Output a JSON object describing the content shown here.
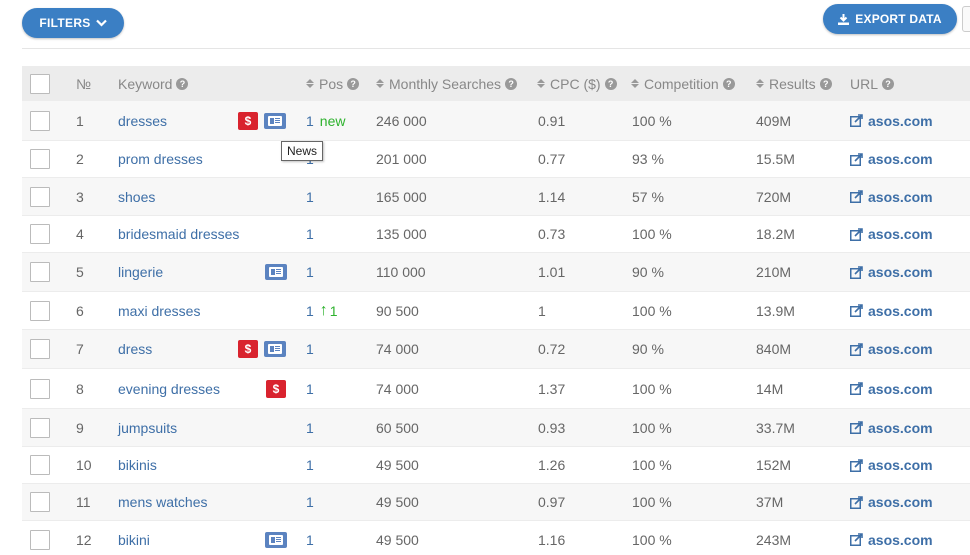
{
  "toolbar": {
    "filters_label": "FILTERS",
    "export_label": "EXPORT DATA"
  },
  "table": {
    "headers": {
      "number": "№",
      "keyword": "Keyword",
      "pos": "Pos",
      "monthly_searches": "Monthly Searches",
      "cpc": "CPC ($)",
      "competition": "Competition",
      "results": "Results",
      "url": "URL"
    },
    "rows": [
      {
        "n": "1",
        "keyword": "dresses",
        "pos": "1",
        "pos_note": "new",
        "searches": "246 000",
        "cpc": "0.91",
        "competition": "100 %",
        "results": "409M",
        "url": "asos.com",
        "badges": [
          "dollar-icon",
          "news-icon"
        ]
      },
      {
        "n": "2",
        "keyword": "prom dresses",
        "pos": "1",
        "searches": "201 000",
        "cpc": "0.77",
        "competition": "93 %",
        "results": "15.5M",
        "url": "asos.com",
        "badges": []
      },
      {
        "n": "3",
        "keyword": "shoes",
        "pos": "1",
        "searches": "165 000",
        "cpc": "1.14",
        "competition": "57 %",
        "results": "720M",
        "url": "asos.com",
        "badges": []
      },
      {
        "n": "4",
        "keyword": "bridesmaid dresses",
        "pos": "1",
        "searches": "135 000",
        "cpc": "0.73",
        "competition": "100 %",
        "results": "18.2M",
        "url": "asos.com",
        "badges": []
      },
      {
        "n": "5",
        "keyword": "lingerie",
        "pos": "1",
        "searches": "110 000",
        "cpc": "1.01",
        "competition": "90 %",
        "results": "210M",
        "url": "asos.com",
        "badges": [
          "news-icon"
        ]
      },
      {
        "n": "6",
        "keyword": "maxi dresses",
        "pos": "1",
        "pos_change": "1",
        "searches": "90 500",
        "cpc": "1",
        "competition": "100 %",
        "results": "13.9M",
        "url": "asos.com",
        "badges": []
      },
      {
        "n": "7",
        "keyword": "dress",
        "pos": "1",
        "searches": "74 000",
        "cpc": "0.72",
        "competition": "90 %",
        "results": "840M",
        "url": "asos.com",
        "badges": [
          "dollar-icon",
          "news-icon"
        ]
      },
      {
        "n": "8",
        "keyword": "evening dresses",
        "pos": "1",
        "searches": "74 000",
        "cpc": "1.37",
        "competition": "100 %",
        "results": "14M",
        "url": "asos.com",
        "badges": [
          "dollar-icon"
        ]
      },
      {
        "n": "9",
        "keyword": "jumpsuits",
        "pos": "1",
        "searches": "60 500",
        "cpc": "0.93",
        "competition": "100 %",
        "results": "33.7M",
        "url": "asos.com",
        "badges": []
      },
      {
        "n": "10",
        "keyword": "bikinis",
        "pos": "1",
        "searches": "49 500",
        "cpc": "1.26",
        "competition": "100 %",
        "results": "152M",
        "url": "asos.com",
        "badges": []
      },
      {
        "n": "11",
        "keyword": "mens watches",
        "pos": "1",
        "searches": "49 500",
        "cpc": "0.97",
        "competition": "100 %",
        "results": "37M",
        "url": "asos.com",
        "badges": []
      },
      {
        "n": "12",
        "keyword": "bikini",
        "pos": "1",
        "searches": "49 500",
        "cpc": "1.16",
        "competition": "100 %",
        "results": "243M",
        "url": "asos.com",
        "badges": [
          "news-icon"
        ]
      }
    ]
  },
  "tooltip": {
    "text": "News"
  },
  "badges": {
    "dollar_symbol": "$"
  },
  "colors": {
    "accent": "#3b7fc4",
    "link": "#3e6fa7",
    "positive": "#2eb22e",
    "dollar_badge": "#d9232e",
    "news_badge": "#5b83c0"
  }
}
